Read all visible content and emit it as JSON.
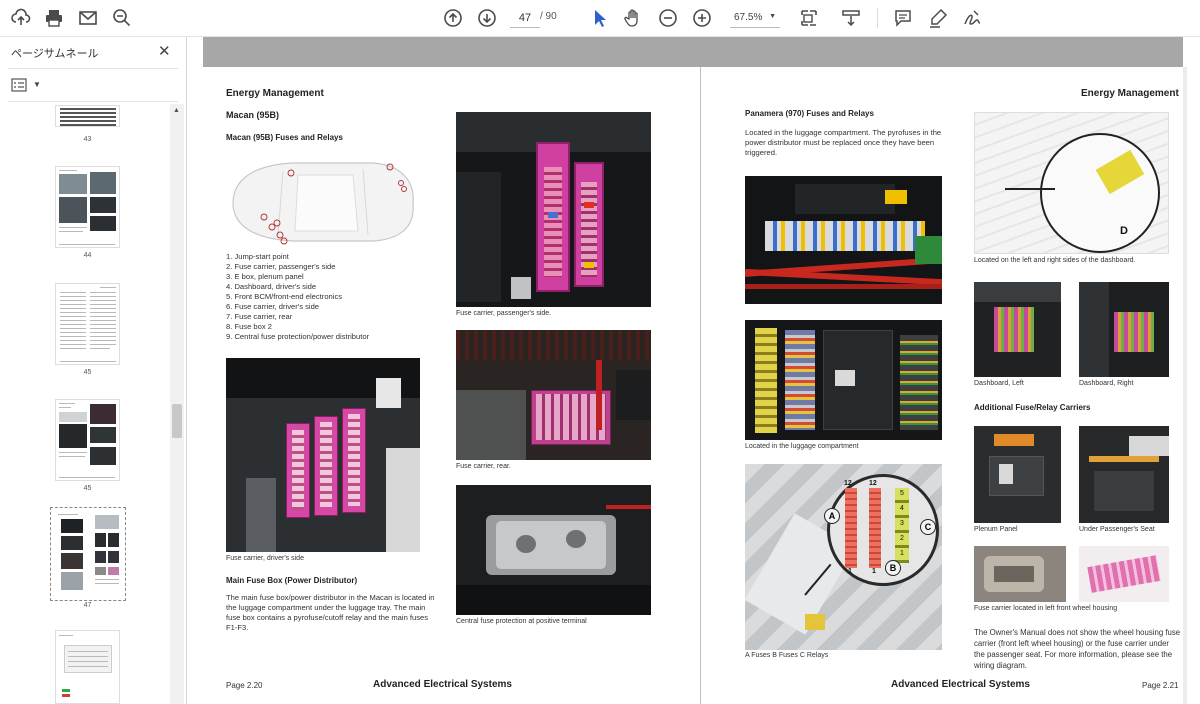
{
  "toolbar": {
    "page_current": "47",
    "page_total": "/ 90",
    "zoom": "67.5%",
    "icons": [
      "upload-icon",
      "print-icon",
      "email-icon",
      "search-icon",
      "page-up-icon",
      "page-down-icon",
      "select-cursor-icon",
      "hand-icon",
      "zoom-out-icon",
      "zoom-in-icon",
      "fit-page-icon",
      "scroll-mode-icon",
      "comment-icon",
      "highlight-icon",
      "sign-icon"
    ]
  },
  "sidebar": {
    "title": "ページサムネール",
    "thumbnails": [
      {
        "label": "43"
      },
      {
        "label": "44"
      },
      {
        "label": "45"
      },
      {
        "label": "45"
      },
      {
        "label": "47"
      }
    ]
  },
  "left_page": {
    "header": "Energy Management",
    "model": "Macan (95B)",
    "subtitle": "Macan (95B) Fuses and Relays",
    "list": [
      "1. Jump-start point",
      "2. Fuse carrier, passenger's side",
      "3. E box, plenum panel",
      "4. Dashboard, driver's side",
      "5. Front BCM/front-end electronics",
      "6. Fuse carrier, driver's side",
      "7. Fuse carrier, rear",
      "8. Fuse box 2",
      "9. Central fuse protection/power distributor"
    ],
    "captions": {
      "passenger": "Fuse carrier, passenger's side.",
      "rear": "Fuse carrier, rear.",
      "driver": "Fuse carrier, driver's side",
      "central": "Central fuse protection at positive terminal"
    },
    "main_fuse_title": "Main Fuse Box (Power Distributor)",
    "main_fuse_text": [
      "The main fuse box/power distributor in the Macan is located in",
      "the luggage compartment under the luggage tray. The main",
      "fuse box contains a pyrofuse/cutoff relay and the main fuses",
      "F1-F3."
    ],
    "footer_page": "Page 2.20",
    "footer_title": "Advanced Electrical Systems"
  },
  "right_page": {
    "header": "Energy Management",
    "subtitle": "Panamera (970) Fuses and Relays",
    "intro": [
      "Located in the luggage compartment. The pyrofuses in the",
      "power distributor must be replaced once they have been",
      "triggered."
    ],
    "captions": {
      "luggage": "Located in the luggage compartment",
      "abc": "A  Fuses    B  Fuses    C  Relays",
      "dashboard_sides": "Located on the left and right sides of the dashboard.",
      "dash_left": "Dashboard, Left",
      "dash_right": "Dashboard, Right",
      "plenum": "Plenum Panel",
      "under_seat": "Under Passenger's Seat",
      "wheel_housing": "Fuse carrier located in left front wheel housing"
    },
    "additional_title": "Additional Fuse/Relay Carriers",
    "owners_text": [
      "The Owner's Manual does not show the wheel housing fuse",
      "carrier (front left wheel housing) or the fuse carrier under",
      "the passenger seat. For more information, please see the",
      "wiring diagram."
    ],
    "diagram_labels": {
      "a": "A",
      "b": "B",
      "c": "C",
      "d": "D",
      "n12a": "12",
      "n12b": "12",
      "n1a": "1",
      "n1b": "1",
      "r5": "5",
      "r4": "4",
      "r3": "3",
      "r2": "2",
      "r1": "1"
    },
    "footer_page": "Page 2.21",
    "footer_title": "Advanced Electrical Systems"
  },
  "car_markers": [
    "1",
    "2",
    "3",
    "4",
    "5",
    "6",
    "7",
    "8",
    "9"
  ],
  "colors": {
    "accent": "#e040a0",
    "fuse_yellow": "#f0d000",
    "fuse_red": "#e03020",
    "fuse_blue": "#4a6fd0",
    "photo_dark": "#1e2124"
  }
}
